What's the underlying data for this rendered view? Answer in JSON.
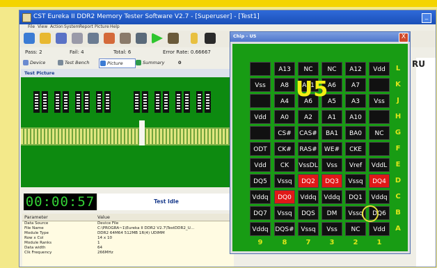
{
  "window": {
    "title": "CST Eureka II DDR2 Memory Tester Software V2.7 - [Superuser] - [Test1]"
  },
  "menu": [
    "File",
    "View",
    "Action",
    "System",
    "Report",
    "Picture",
    "Help"
  ],
  "toolbar_icons": [
    "pcb-icon",
    "open-folder-icon",
    "save-icon",
    "print-icon",
    "settings-icon",
    "chips-icon",
    "options-icon",
    "tool-icon",
    "run-icon",
    "loop-icon",
    "bulb-icon",
    "memory-icon"
  ],
  "stats": {
    "pass": "Pass: 2",
    "fail": "Fail: 4",
    "total": "Total: 6",
    "error_rate": "Error Rate: 0.66667"
  },
  "tabs": [
    "Device",
    "Test Bench",
    "Picture",
    "Summary"
  ],
  "tab_extra": "0",
  "section_title": "Test Picture",
  "clock": "00:00:57",
  "status": "Test Idle",
  "right_text": "RU",
  "params": {
    "headers": [
      "Parameter",
      "Value"
    ],
    "rows": [
      {
        "k": "Data Source",
        "v": "Device File"
      },
      {
        "k": "File Name",
        "v": "C:\\PROGRA~1\\Eureka II DDR2 V2.7\\TestDDR2_U..."
      },
      {
        "k": "Module Type",
        "v": "DDR2 64M64 512MB 1R(4) UDIMM"
      },
      {
        "k": "Row x Col",
        "v": "14 x 10"
      },
      {
        "k": "Module Ranks",
        "v": "1"
      },
      {
        "k": "Data width",
        "v": "64"
      },
      {
        "k": "Clk Frequency",
        "v": "266MHz"
      }
    ]
  },
  "dialog": {
    "title": "Chip - U5",
    "close": "X",
    "chip_label": "U5",
    "row_labels": [
      "L",
      "K",
      "J",
      "H",
      "G",
      "F",
      "E",
      "D",
      "C",
      "B",
      "A"
    ],
    "col_labels": [
      "9",
      "8",
      "7",
      "3",
      "2",
      "1"
    ],
    "grid": [
      [
        "",
        "A13",
        "NC",
        "NC",
        "A12",
        "Vdd"
      ],
      [
        "Vss",
        "A8",
        "A11",
        "A6",
        "A7",
        ""
      ],
      [
        "",
        "A4",
        "A6",
        "A5",
        "A3",
        "Vss"
      ],
      [
        "Vdd",
        "A0",
        "A2",
        "A1",
        "A10",
        ""
      ],
      [
        "",
        "CS#",
        "CAS#",
        "BA1",
        "BA0",
        "NC"
      ],
      [
        "ODT",
        "CK#",
        "RAS#",
        "WE#",
        "CKE",
        ""
      ],
      [
        "Vdd",
        "CK",
        "VssDL",
        "Vss",
        "Vref",
        "VddL"
      ],
      [
        "DQ5",
        "Vssq",
        "DQ2",
        "DQ3",
        "Vssq",
        "DQ4"
      ],
      [
        "Vddq",
        "DQ0",
        "Vddq",
        "Vddq",
        "DQ1",
        "Vddq"
      ],
      [
        "DQ7",
        "Vssq",
        "DQS",
        "DM",
        "Vssq",
        "DQ6"
      ],
      [
        "Vddq",
        "DQS#",
        "Vssq",
        "Vss",
        "NC",
        "Vdd"
      ]
    ],
    "failed_pins": [
      "DQ2",
      "DQ3",
      "DQ4",
      "DQ0"
    ]
  },
  "colors": {
    "board_green": "#0d8a10",
    "pin_fail": "#e01818",
    "label_yellow": "#dde61a",
    "title_blue": "#2f6ad8"
  }
}
